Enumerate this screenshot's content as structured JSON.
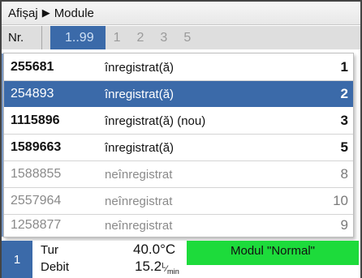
{
  "header": {
    "path_root": "Afișaj",
    "path_child": "Module"
  },
  "filterbar": {
    "nr_label": "Nr.",
    "tabs": [
      {
        "label": "1..99",
        "active": true
      },
      {
        "label": "1",
        "active": false
      },
      {
        "label": "2",
        "active": false
      },
      {
        "label": "3",
        "active": false
      },
      {
        "label": "5",
        "active": false
      }
    ]
  },
  "modules": [
    {
      "number": "255681",
      "status": "înregistrat(ă)",
      "index": "1",
      "state": "active"
    },
    {
      "number": "254893",
      "status": "înregistrat(ă)",
      "index": "2",
      "state": "selected"
    },
    {
      "number": "1115896",
      "status": "înregistrat(ă) (nou)",
      "index": "3",
      "state": "active"
    },
    {
      "number": "1589663",
      "status": "înregistrat(ă)",
      "index": "5",
      "state": "active"
    },
    {
      "number": "1588855",
      "status": "neînregistrat",
      "index": "8",
      "state": "inactive"
    },
    {
      "number": "2557964",
      "status": "neînregistrat",
      "index": "10",
      "state": "inactive"
    },
    {
      "number": "1258877",
      "status": "neînregistrat",
      "index": "9",
      "state": "inactive"
    }
  ],
  "bottom": {
    "circuit": "1",
    "flow_label": "Tur",
    "flow_value": "40.0",
    "flow_unit": "°C",
    "debit_label": "Debit",
    "debit_value": "15.2",
    "debit_unit_num": "L",
    "debit_unit_den": "min",
    "mode": "Modul \"Normal\""
  },
  "colors": {
    "accent": "#3b6aa9",
    "mode_green": "#1ddb3b"
  }
}
